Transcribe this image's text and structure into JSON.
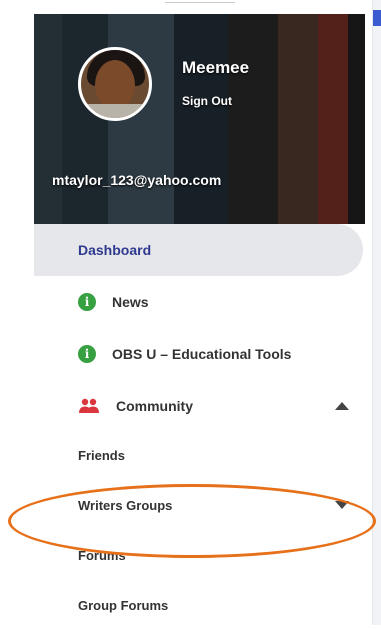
{
  "profile": {
    "username": "Meemee",
    "sign_out_label": "Sign Out",
    "email": "mtaylor_123@yahoo.com"
  },
  "menu": {
    "items": [
      {
        "label": "Dashboard",
        "active": true
      },
      {
        "label": "News",
        "icon": "info-icon"
      },
      {
        "label": "OBS U – Educational Tools",
        "icon": "info-icon"
      },
      {
        "label": "Community",
        "icon": "people-icon",
        "expanded": true
      }
    ]
  },
  "community_submenu": {
    "items": [
      {
        "label": "Friends"
      },
      {
        "label": "Writers Groups",
        "has_dropdown": true
      },
      {
        "label": "Forums"
      },
      {
        "label": "Group Forums"
      }
    ]
  },
  "colors": {
    "active_text": "#2f3a8f",
    "info_icon": "#37a041",
    "community_icon": "#d9363e",
    "annotation": "#e7711b"
  }
}
